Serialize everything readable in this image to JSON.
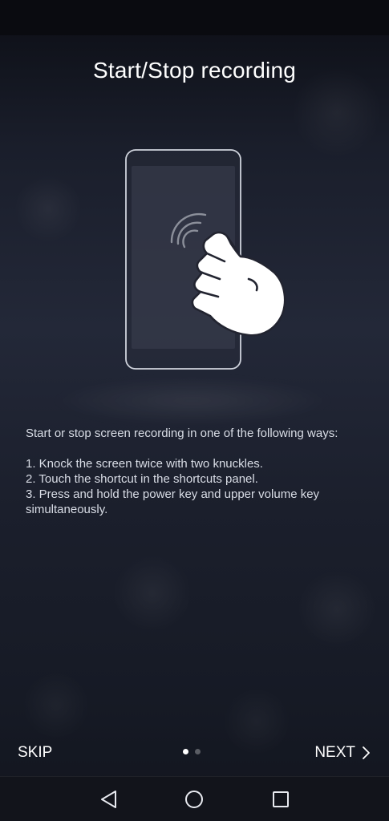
{
  "title": "Start/Stop recording",
  "description": {
    "intro": "Start or stop screen recording in one of the following ways:",
    "steps": [
      "1. Knock the screen twice with two knuckles.",
      "2. Touch the shortcut in the shortcuts panel.",
      "3. Press and hold the power key and upper volume key simultaneously."
    ]
  },
  "illustration": {
    "phone_icon": "phone-outline-icon",
    "gesture_icon": "knuckle-tap-hand-icon",
    "wave_icon": "tap-wave-icon"
  },
  "footer": {
    "skip_label": "SKIP",
    "next_label": "NEXT",
    "next_icon": "chevron-right-icon",
    "page_count": 2,
    "current_page": 1
  },
  "nav": {
    "back_icon": "back-triangle-icon",
    "home_icon": "home-circle-icon",
    "recents_icon": "recents-square-icon"
  },
  "colors": {
    "text_primary": "#ffffff",
    "text_secondary": "#d9dde6",
    "background": "#1c2030"
  }
}
